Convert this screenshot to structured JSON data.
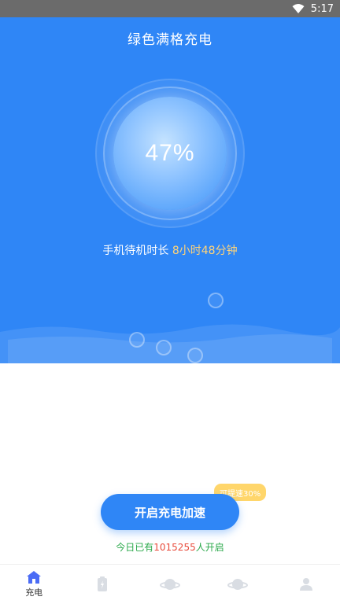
{
  "status_bar": {
    "time": "5:17"
  },
  "header": {
    "title": "绿色满格充电"
  },
  "battery": {
    "percent_text": "47%",
    "level": 47
  },
  "standby": {
    "label": "手机待机时长 ",
    "value": "8小时48分钟"
  },
  "cta": {
    "button_label": "开启充电加速",
    "badge": "可提速30%"
  },
  "today": {
    "prefix": "今日已有",
    "count": "1015255",
    "suffix": "人开启"
  },
  "tabbar": {
    "items": [
      {
        "label": "充电",
        "icon": "home-icon",
        "active": true
      },
      {
        "label": "",
        "icon": "battery-icon",
        "active": false
      },
      {
        "label": "",
        "icon": "planet-icon",
        "active": false
      },
      {
        "label": "",
        "icon": "planet-icon",
        "active": false
      },
      {
        "label": "",
        "icon": "user-icon",
        "active": false
      }
    ]
  },
  "colors": {
    "primary": "#2f86f6",
    "badge": "#ffd66b",
    "accent_text": "#ffd479",
    "green": "#2aa84a",
    "red": "#e84b3c"
  }
}
